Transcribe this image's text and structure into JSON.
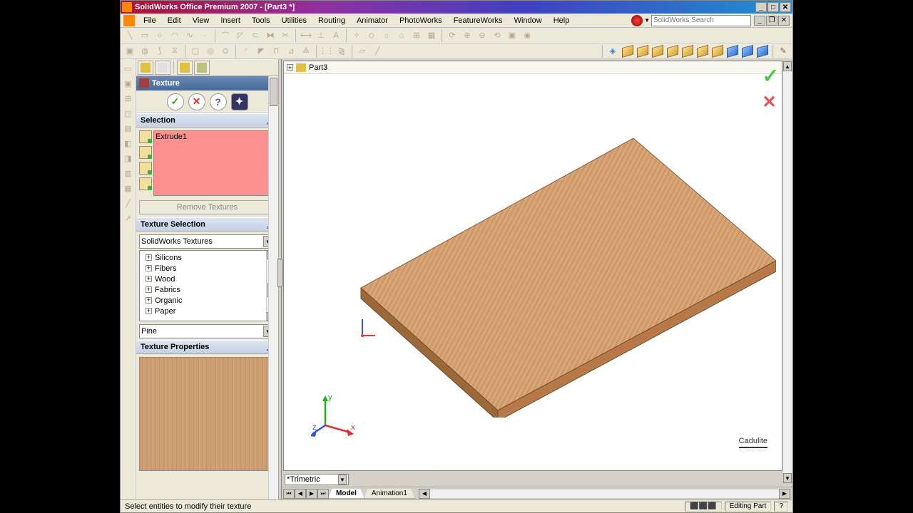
{
  "title": "SolidWorks Office Premium 2007 - [Part3 *]",
  "menu": [
    "File",
    "Edit",
    "View",
    "Insert",
    "Tools",
    "Utilities",
    "Routing",
    "Animator",
    "PhotoWorks",
    "FeatureWorks",
    "Window",
    "Help"
  ],
  "search_placeholder": "SolidWorks Search",
  "breadcrumb": {
    "part": "Part3"
  },
  "property_manager": {
    "header": "Texture",
    "sections": {
      "selection": {
        "title": "Selection",
        "item": "Extrude1",
        "remove": "Remove Textures"
      },
      "texture_selection": {
        "title": "Texture Selection",
        "source": "SolidWorks Textures",
        "tree": [
          "Silicons",
          "Fibers",
          "Wood",
          "Fabrics",
          "Organic",
          "Paper"
        ],
        "selected": "Pine"
      },
      "texture_properties": {
        "title": "Texture Properties"
      }
    }
  },
  "view_dropdown": "*Trimetric",
  "tabs": [
    "Model",
    "Animation1"
  ],
  "status": {
    "hint": "Select entities to modify their texture",
    "mode": "Editing Part"
  },
  "triad": {
    "x": "x",
    "y": "y",
    "z": "z"
  },
  "watermark": "Cadulite"
}
